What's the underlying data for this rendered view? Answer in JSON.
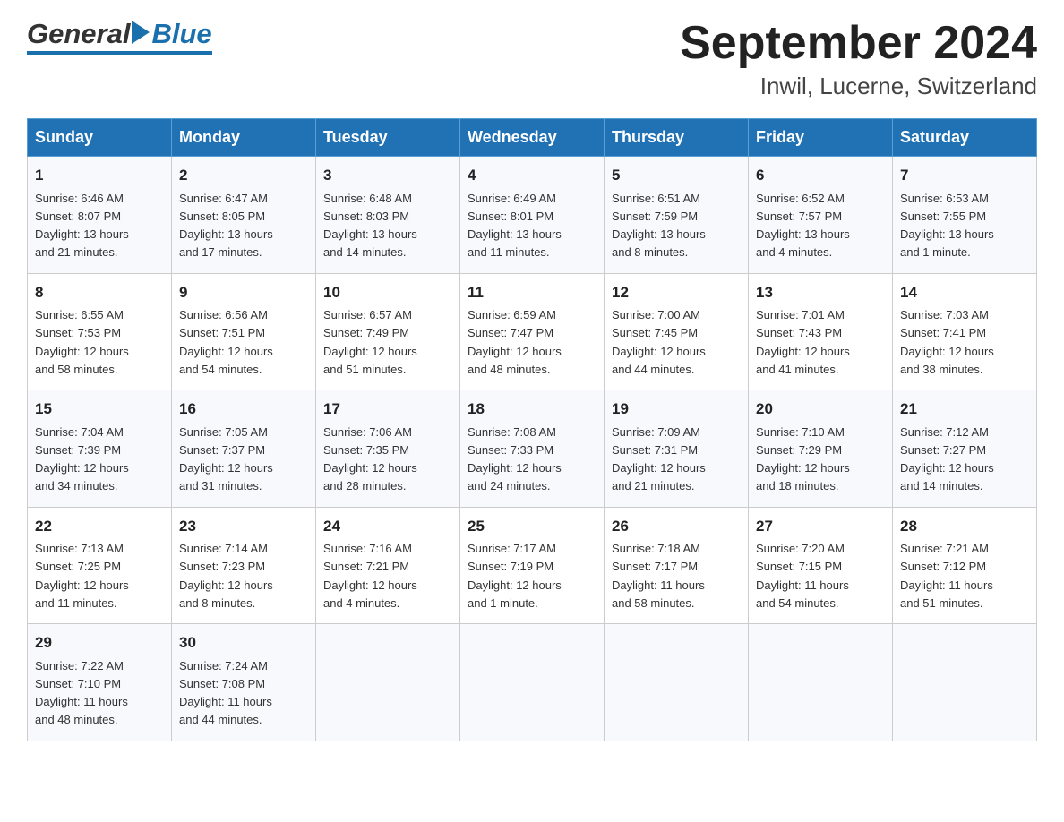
{
  "header": {
    "title": "September 2024",
    "subtitle": "Inwil, Lucerne, Switzerland",
    "logo_general": "General",
    "logo_blue": "Blue"
  },
  "days_of_week": [
    "Sunday",
    "Monday",
    "Tuesday",
    "Wednesday",
    "Thursday",
    "Friday",
    "Saturday"
  ],
  "weeks": [
    [
      {
        "day": "1",
        "sunrise": "6:46 AM",
        "sunset": "8:07 PM",
        "daylight": "13 hours and 21 minutes."
      },
      {
        "day": "2",
        "sunrise": "6:47 AM",
        "sunset": "8:05 PM",
        "daylight": "13 hours and 17 minutes."
      },
      {
        "day": "3",
        "sunrise": "6:48 AM",
        "sunset": "8:03 PM",
        "daylight": "13 hours and 14 minutes."
      },
      {
        "day": "4",
        "sunrise": "6:49 AM",
        "sunset": "8:01 PM",
        "daylight": "13 hours and 11 minutes."
      },
      {
        "day": "5",
        "sunrise": "6:51 AM",
        "sunset": "7:59 PM",
        "daylight": "13 hours and 8 minutes."
      },
      {
        "day": "6",
        "sunrise": "6:52 AM",
        "sunset": "7:57 PM",
        "daylight": "13 hours and 4 minutes."
      },
      {
        "day": "7",
        "sunrise": "6:53 AM",
        "sunset": "7:55 PM",
        "daylight": "13 hours and 1 minute."
      }
    ],
    [
      {
        "day": "8",
        "sunrise": "6:55 AM",
        "sunset": "7:53 PM",
        "daylight": "12 hours and 58 minutes."
      },
      {
        "day": "9",
        "sunrise": "6:56 AM",
        "sunset": "7:51 PM",
        "daylight": "12 hours and 54 minutes."
      },
      {
        "day": "10",
        "sunrise": "6:57 AM",
        "sunset": "7:49 PM",
        "daylight": "12 hours and 51 minutes."
      },
      {
        "day": "11",
        "sunrise": "6:59 AM",
        "sunset": "7:47 PM",
        "daylight": "12 hours and 48 minutes."
      },
      {
        "day": "12",
        "sunrise": "7:00 AM",
        "sunset": "7:45 PM",
        "daylight": "12 hours and 44 minutes."
      },
      {
        "day": "13",
        "sunrise": "7:01 AM",
        "sunset": "7:43 PM",
        "daylight": "12 hours and 41 minutes."
      },
      {
        "day": "14",
        "sunrise": "7:03 AM",
        "sunset": "7:41 PM",
        "daylight": "12 hours and 38 minutes."
      }
    ],
    [
      {
        "day": "15",
        "sunrise": "7:04 AM",
        "sunset": "7:39 PM",
        "daylight": "12 hours and 34 minutes."
      },
      {
        "day": "16",
        "sunrise": "7:05 AM",
        "sunset": "7:37 PM",
        "daylight": "12 hours and 31 minutes."
      },
      {
        "day": "17",
        "sunrise": "7:06 AM",
        "sunset": "7:35 PM",
        "daylight": "12 hours and 28 minutes."
      },
      {
        "day": "18",
        "sunrise": "7:08 AM",
        "sunset": "7:33 PM",
        "daylight": "12 hours and 24 minutes."
      },
      {
        "day": "19",
        "sunrise": "7:09 AM",
        "sunset": "7:31 PM",
        "daylight": "12 hours and 21 minutes."
      },
      {
        "day": "20",
        "sunrise": "7:10 AM",
        "sunset": "7:29 PM",
        "daylight": "12 hours and 18 minutes."
      },
      {
        "day": "21",
        "sunrise": "7:12 AM",
        "sunset": "7:27 PM",
        "daylight": "12 hours and 14 minutes."
      }
    ],
    [
      {
        "day": "22",
        "sunrise": "7:13 AM",
        "sunset": "7:25 PM",
        "daylight": "12 hours and 11 minutes."
      },
      {
        "day": "23",
        "sunrise": "7:14 AM",
        "sunset": "7:23 PM",
        "daylight": "12 hours and 8 minutes."
      },
      {
        "day": "24",
        "sunrise": "7:16 AM",
        "sunset": "7:21 PM",
        "daylight": "12 hours and 4 minutes."
      },
      {
        "day": "25",
        "sunrise": "7:17 AM",
        "sunset": "7:19 PM",
        "daylight": "12 hours and 1 minute."
      },
      {
        "day": "26",
        "sunrise": "7:18 AM",
        "sunset": "7:17 PM",
        "daylight": "11 hours and 58 minutes."
      },
      {
        "day": "27",
        "sunrise": "7:20 AM",
        "sunset": "7:15 PM",
        "daylight": "11 hours and 54 minutes."
      },
      {
        "day": "28",
        "sunrise": "7:21 AM",
        "sunset": "7:12 PM",
        "daylight": "11 hours and 51 minutes."
      }
    ],
    [
      {
        "day": "29",
        "sunrise": "7:22 AM",
        "sunset": "7:10 PM",
        "daylight": "11 hours and 48 minutes."
      },
      {
        "day": "30",
        "sunrise": "7:24 AM",
        "sunset": "7:08 PM",
        "daylight": "11 hours and 44 minutes."
      },
      null,
      null,
      null,
      null,
      null
    ]
  ],
  "labels": {
    "sunrise": "Sunrise:",
    "sunset": "Sunset:",
    "daylight": "Daylight:"
  }
}
